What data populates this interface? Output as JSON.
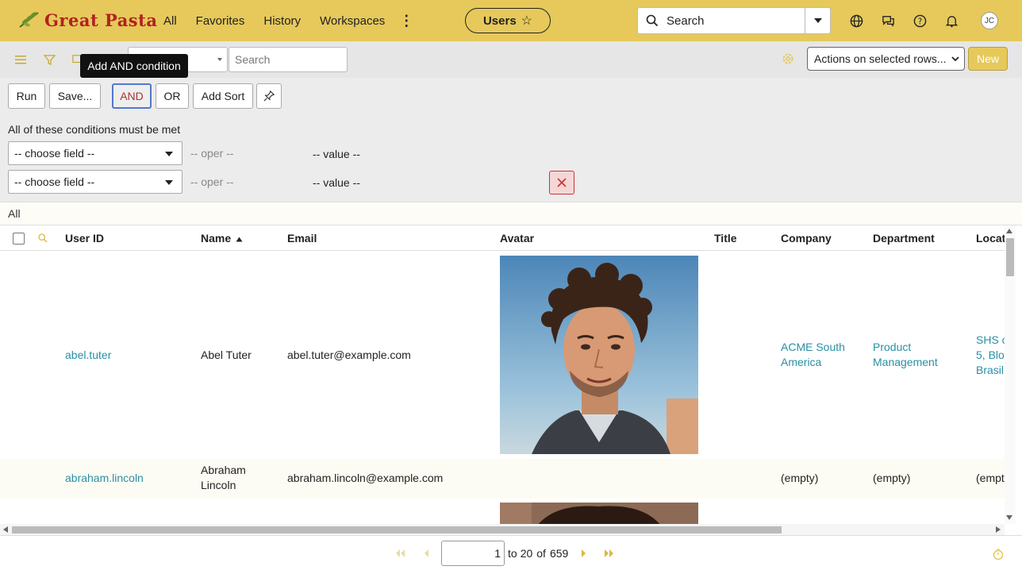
{
  "header": {
    "logo_text": "Great Pasta",
    "nav": [
      "All",
      "Favorites",
      "History",
      "Workspaces"
    ],
    "context_title": "Users",
    "search_placeholder": "Search",
    "user_initials": "JC"
  },
  "toolbar": {
    "list_search_placeholder": "Search",
    "tooltip": "Add AND condition",
    "actions_label": "Actions on selected rows...",
    "new_label": "New"
  },
  "filter": {
    "run_label": "Run",
    "save_label": "Save...",
    "and_label": "AND",
    "or_label": "OR",
    "add_sort_label": "Add Sort",
    "conditions_heading": "All of these conditions must be met",
    "conditions": [
      {
        "field": "-- choose field --",
        "oper": "-- oper --",
        "value": "-- value --"
      },
      {
        "field": "-- choose field --",
        "oper": "-- oper --",
        "value": "-- value --"
      }
    ]
  },
  "breadcrumb": "All",
  "table": {
    "columns": [
      "User ID",
      "Name",
      "Email",
      "Avatar",
      "Title",
      "Company",
      "Department",
      "Locat"
    ],
    "rows": [
      {
        "user_id": "abel.tuter",
        "name": "Abel Tuter",
        "email": "abel.tuter@example.com",
        "company": [
          "ACME South",
          "America"
        ],
        "department": [
          "Product",
          "Management"
        ],
        "location": [
          "SHS c",
          "5, Blo",
          "Brasil"
        ]
      },
      {
        "user_id": "abraham.lincoln",
        "name": [
          "Abraham",
          "Lincoln"
        ],
        "email": "abraham.lincoln@example.com",
        "company": "(empty)",
        "department": "(empty)",
        "location": "(empt"
      }
    ]
  },
  "pagination": {
    "page": "1",
    "to_text": "to",
    "to_value": "20",
    "of_text": "of",
    "total": "659"
  },
  "colors": {
    "brand": "#e6c95a",
    "link": "#2a8fa3",
    "accent_red": "#b22222"
  }
}
